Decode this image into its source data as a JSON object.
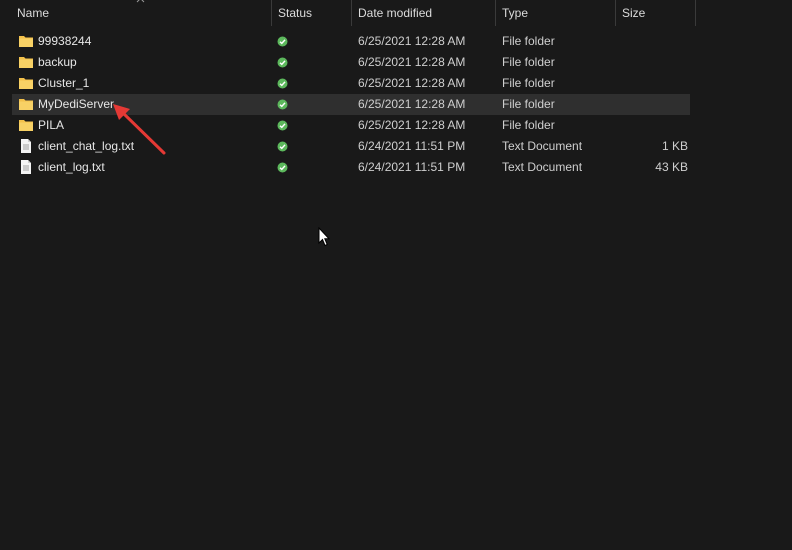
{
  "columns": {
    "name": "Name",
    "status": "Status",
    "date_modified": "Date modified",
    "type": "Type",
    "size": "Size"
  },
  "files": [
    {
      "name": "99938244",
      "icon": "folder-icon",
      "status": "synced",
      "date": "6/25/2021 12:28 AM",
      "type": "File folder",
      "size": ""
    },
    {
      "name": "backup",
      "icon": "folder-icon",
      "status": "synced",
      "date": "6/25/2021 12:28 AM",
      "type": "File folder",
      "size": ""
    },
    {
      "name": "Cluster_1",
      "icon": "folder-icon",
      "status": "synced",
      "date": "6/25/2021 12:28 AM",
      "type": "File folder",
      "size": ""
    },
    {
      "name": "MyDediServer",
      "icon": "folder-icon",
      "status": "synced",
      "date": "6/25/2021 12:28 AM",
      "type": "File folder",
      "size": ""
    },
    {
      "name": "PILA",
      "icon": "folder-icon",
      "status": "synced",
      "date": "6/25/2021 12:28 AM",
      "type": "File folder",
      "size": ""
    },
    {
      "name": "client_chat_log.txt",
      "icon": "text-file-icon",
      "status": "synced",
      "date": "6/24/2021 11:51 PM",
      "type": "Text Document",
      "size": "1 KB"
    },
    {
      "name": "client_log.txt",
      "icon": "text-file-icon",
      "status": "synced",
      "date": "6/24/2021 11:51 PM",
      "type": "Text Document",
      "size": "43 KB"
    }
  ],
  "colors": {
    "background": "#191919",
    "folder": "#f3c14b",
    "status_ok": "#5cb85c",
    "annotation_arrow": "#e53935",
    "hover_row": "#2f2f2f"
  }
}
